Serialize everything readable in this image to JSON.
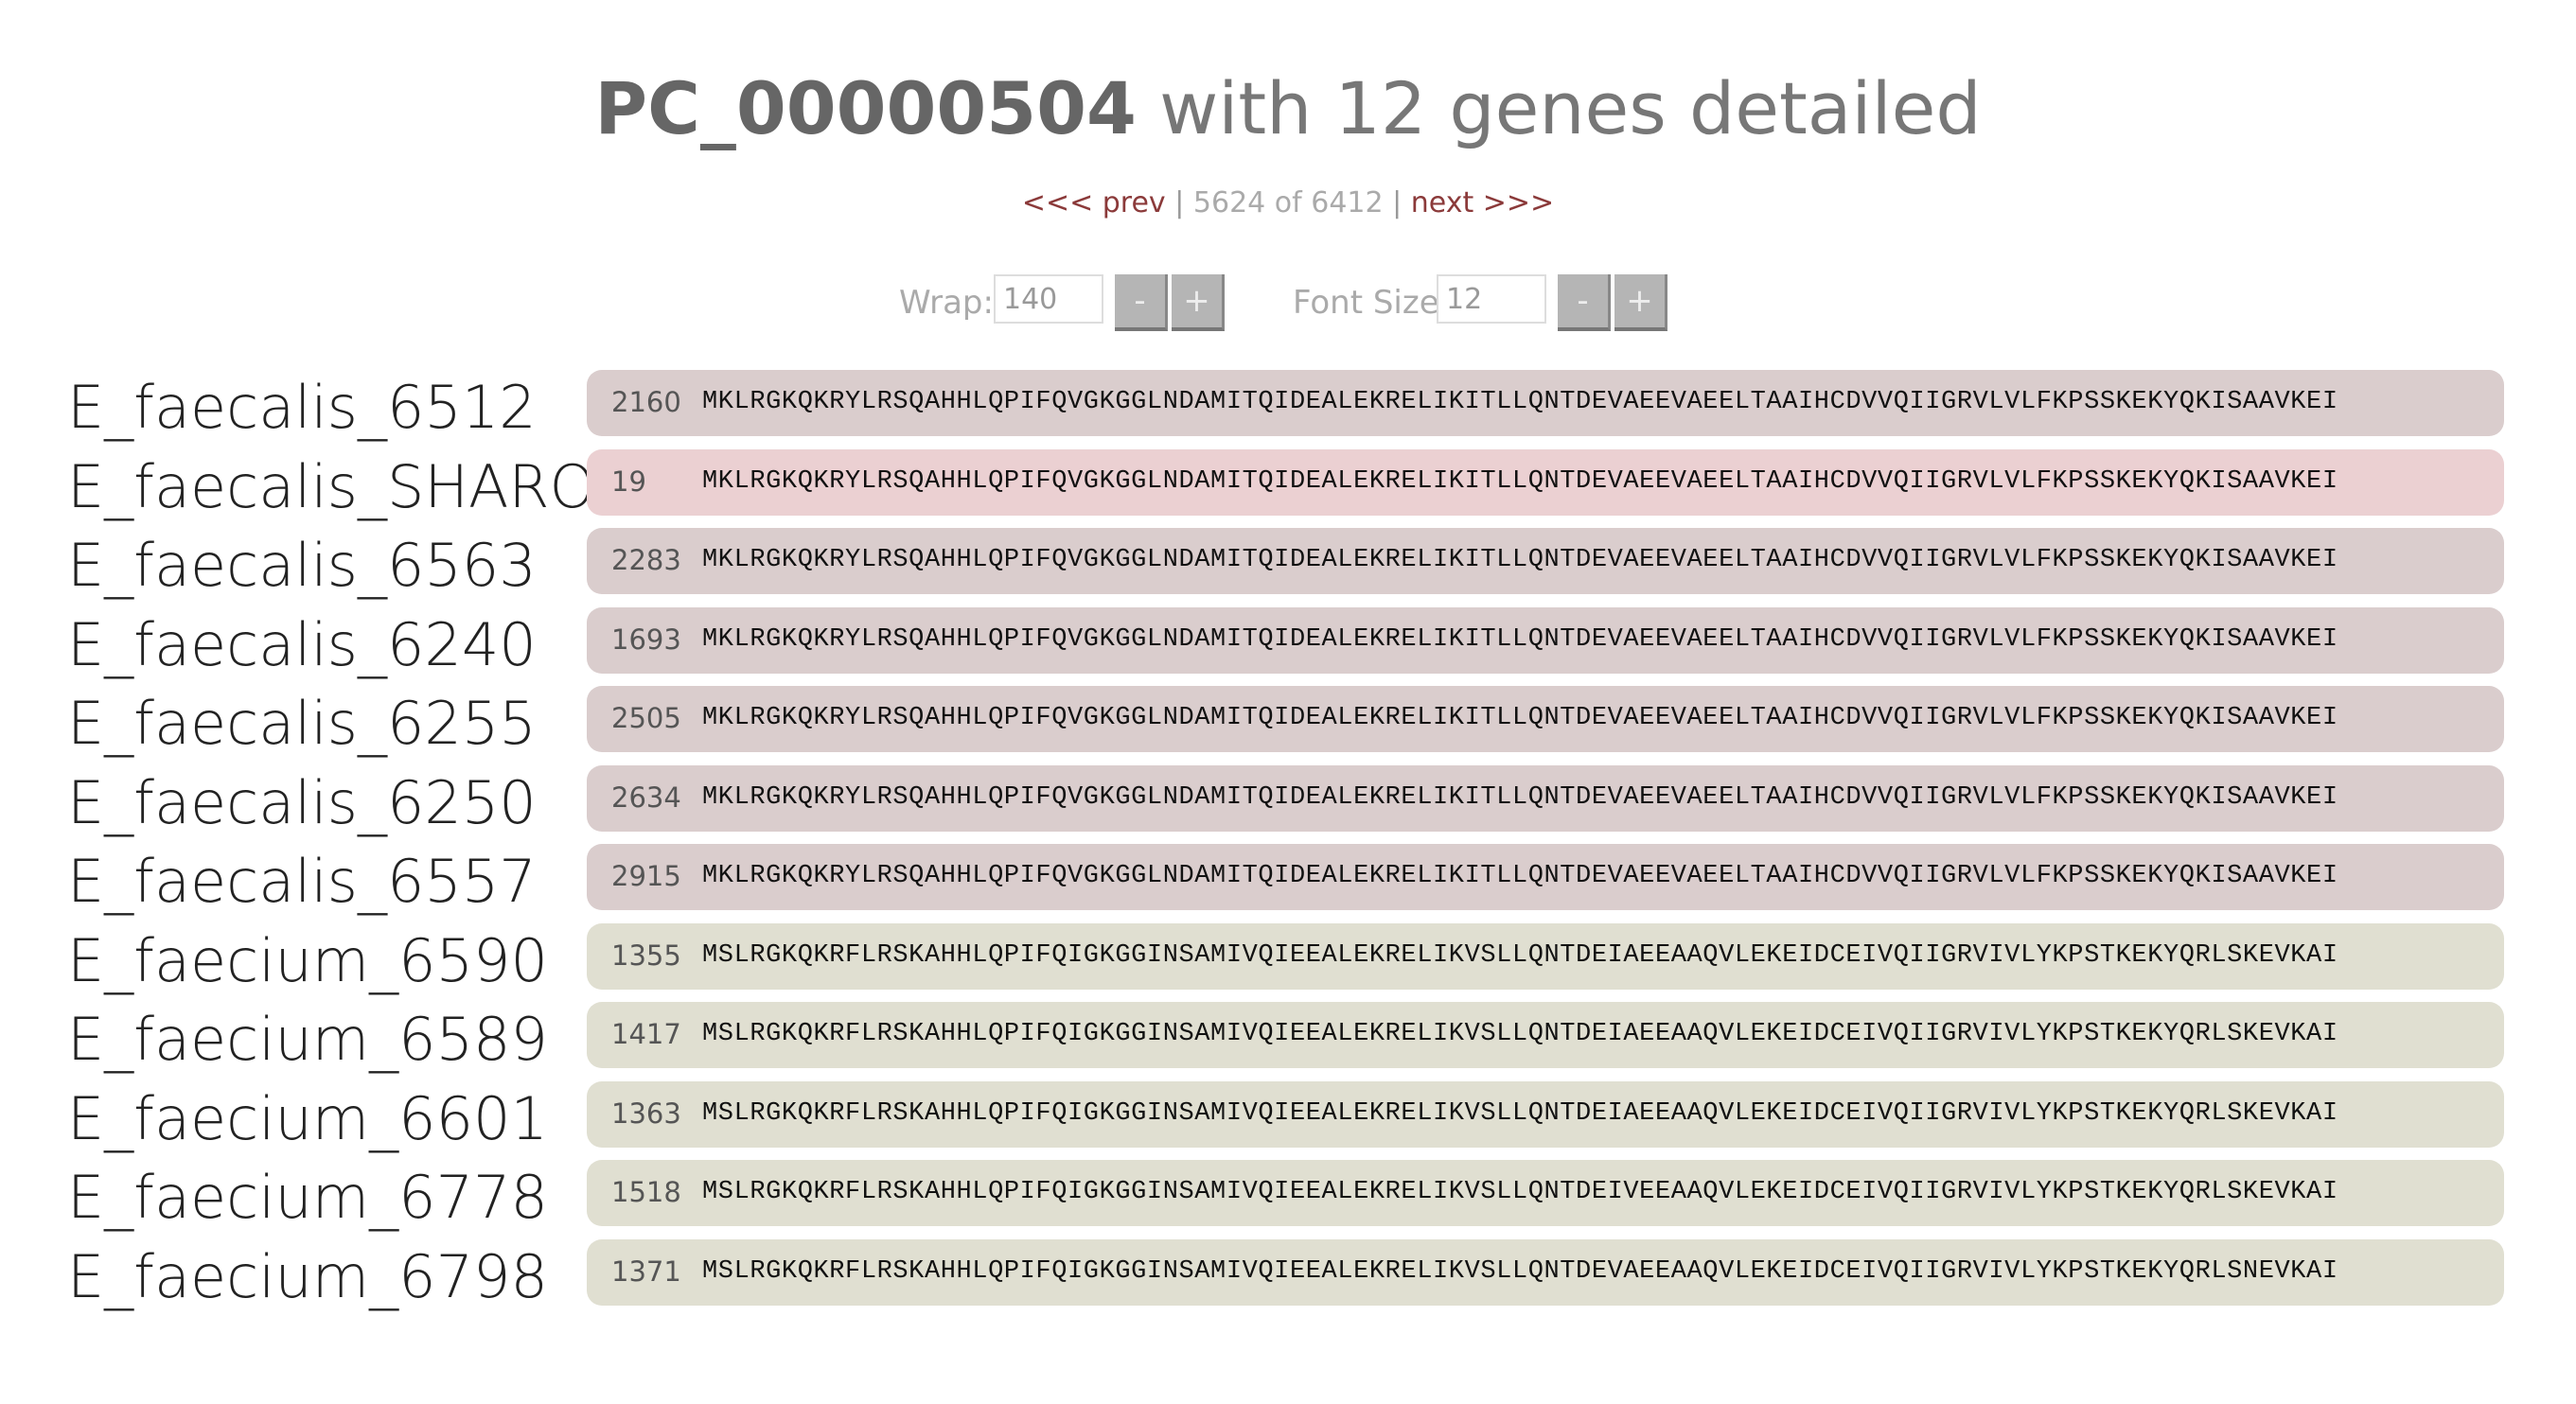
{
  "title": {
    "id": "PC_00000504",
    "rest": " with 12 genes detailed"
  },
  "pager": {
    "prev": "<<< prev",
    "position": "5624 of 6412",
    "next": "next >>>",
    "sep": "|"
  },
  "controls": {
    "wrap_label": "Wrap:",
    "wrap_value": "140",
    "font_label": "Font Size:",
    "font_value": "12",
    "minus": "-",
    "plus": "+"
  },
  "genes": [
    {
      "name": "E_faecalis_6512",
      "pos": "2160",
      "group": "faecalis",
      "seq": "MKLRGKQKRYLRSQAHHLQPIFQVGKGGLNDAMITQIDEALEKRELIKITLLQNTDEVAEEVAEELTAAIHCDVVQIIGRVLVLFKPSSKEKYQKISAAVKEI"
    },
    {
      "name": "E_faecalis_SHARON",
      "pos": "19",
      "group": "faecalis-hl",
      "seq": "MKLRGKQKRYLRSQAHHLQPIFQVGKGGLNDAMITQIDEALEKRELIKITLLQNTDEVAEEVAEELTAAIHCDVVQIIGRVLVLFKPSSKEKYQKISAAVKEI"
    },
    {
      "name": "E_faecalis_6563",
      "pos": "2283",
      "group": "faecalis",
      "seq": "MKLRGKQKRYLRSQAHHLQPIFQVGKGGLNDAMITQIDEALEKRELIKITLLQNTDEVAEEVAEELTAAIHCDVVQIIGRVLVLFKPSSKEKYQKISAAVKEI"
    },
    {
      "name": "E_faecalis_6240",
      "pos": "1693",
      "group": "faecalis",
      "seq": "MKLRGKQKRYLRSQAHHLQPIFQVGKGGLNDAMITQIDEALEKRELIKITLLQNTDEVAEEVAEELTAAIHCDVVQIIGRVLVLFKPSSKEKYQKISAAVKEI"
    },
    {
      "name": "E_faecalis_6255",
      "pos": "2505",
      "group": "faecalis",
      "seq": "MKLRGKQKRYLRSQAHHLQPIFQVGKGGLNDAMITQIDEALEKRELIKITLLQNTDEVAEEVAEELTAAIHCDVVQIIGRVLVLFKPSSKEKYQKISAAVKEI"
    },
    {
      "name": "E_faecalis_6250",
      "pos": "2634",
      "group": "faecalis",
      "seq": "MKLRGKQKRYLRSQAHHLQPIFQVGKGGLNDAMITQIDEALEKRELIKITLLQNTDEVAEEVAEELTAAIHCDVVQIIGRVLVLFKPSSKEKYQKISAAVKEI"
    },
    {
      "name": "E_faecalis_6557",
      "pos": "2915",
      "group": "faecalis",
      "seq": "MKLRGKQKRYLRSQAHHLQPIFQVGKGGLNDAMITQIDEALEKRELIKITLLQNTDEVAEEVAEELTAAIHCDVVQIIGRVLVLFKPSSKEKYQKISAAVKEI"
    },
    {
      "name": "E_faecium_6590",
      "pos": "1355",
      "group": "faecium",
      "seq": "MSLRGKQKRFLRSKAHHLQPIFQIGKGGINSAMIVQIEEALEKRELIKVSLLQNTDEIAEEAAQVLEKEIDCEIVQIIGRVIVLYKPSTKEKYQRLSKEVKAI"
    },
    {
      "name": "E_faecium_6589",
      "pos": "1417",
      "group": "faecium",
      "seq": "MSLRGKQKRFLRSKAHHLQPIFQIGKGGINSAMIVQIEEALEKRELIKVSLLQNTDEIAEEAAQVLEKEIDCEIVQIIGRVIVLYKPSTKEKYQRLSKEVKAI"
    },
    {
      "name": "E_faecium_6601",
      "pos": "1363",
      "group": "faecium",
      "seq": "MSLRGKQKRFLRSKAHHLQPIFQIGKGGINSAMIVQIEEALEKRELIKVSLLQNTDEIAEEAAQVLEKEIDCEIVQIIGRVIVLYKPSTKEKYQRLSKEVKAI"
    },
    {
      "name": "E_faecium_6778",
      "pos": "1518",
      "group": "faecium",
      "seq": "MSLRGKQKRFLRSKAHHLQPIFQIGKGGINSAMIVQIEEALEKRELIKVSLLQNTDEIVEEAAQVLEKEIDCEIVQIIGRVIVLYKPSTKEKYQRLSKEVKAI"
    },
    {
      "name": "E_faecium_6798",
      "pos": "1371",
      "group": "faecium",
      "seq": "MSLRGKQKRFLRSKAHHLQPIFQIGKGGINSAMIVQIEEALEKRELIKVSLLQNTDEVAEEAAQVLEKEIDCEIVQIIGRVIVLYKPSTKEKYQRLSNEVKAI"
    }
  ]
}
